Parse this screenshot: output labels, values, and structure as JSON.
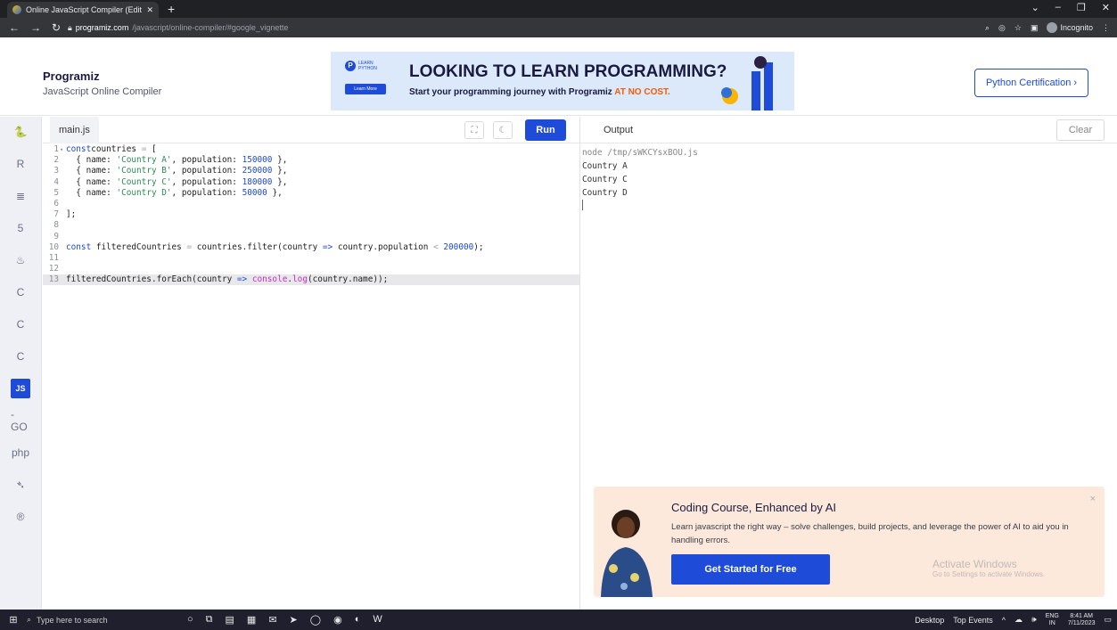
{
  "browser": {
    "tab_title": "Online JavaScript Compiler (Edit",
    "new_tab": "+",
    "url_host": "programiz.com",
    "url_path": "/javascript/online-compiler/#google_vignette",
    "incognito_label": "Incognito"
  },
  "header": {
    "logo": "Programiz",
    "subtitle": "JavaScript Online Compiler",
    "cert_button": "Python Certification ›"
  },
  "banner": {
    "badge_top": "LEARN",
    "badge_bottom": "PYTHON",
    "learn_more": "Learn More",
    "headline": "LOOKING TO LEARN PROGRAMMING?",
    "sub_prefix": "Start your programming journey with Programiz ",
    "sub_highlight": "AT NO COST."
  },
  "sidebar": {
    "items": [
      {
        "icon": "python-icon",
        "glyph": "🐍"
      },
      {
        "icon": "r-lang-icon",
        "glyph": "R"
      },
      {
        "icon": "sql-icon",
        "glyph": "≣"
      },
      {
        "icon": "html-icon",
        "glyph": "5"
      },
      {
        "icon": "java-icon",
        "glyph": "♨"
      },
      {
        "icon": "c-lang-icon",
        "glyph": "C"
      },
      {
        "icon": "cpp-icon",
        "glyph": "C"
      },
      {
        "icon": "csharp-icon",
        "glyph": "C"
      },
      {
        "icon": "javascript-icon",
        "glyph": "JS"
      },
      {
        "icon": "go-icon",
        "glyph": "-GO"
      },
      {
        "icon": "php-icon",
        "glyph": "php"
      },
      {
        "icon": "swift-icon",
        "glyph": "➴"
      },
      {
        "icon": "rust-icon",
        "glyph": "®"
      }
    ]
  },
  "editor": {
    "file_name": "main.js",
    "run_label": "Run",
    "lines": [
      {
        "n": "1",
        "fold": "▾",
        "tokens": [
          [
            "kw",
            "const"
          ],
          [
            "",
            "countries "
          ],
          [
            "op",
            "="
          ],
          [
            "",
            " ["
          ]
        ]
      },
      {
        "n": "2",
        "tokens": [
          [
            "",
            "  { name: "
          ],
          [
            "str",
            "'Country A'"
          ],
          [
            "",
            ", population: "
          ],
          [
            "num",
            "150000"
          ],
          [
            "",
            " },"
          ]
        ]
      },
      {
        "n": "3",
        "tokens": [
          [
            "",
            "  { name: "
          ],
          [
            "str",
            "'Country B'"
          ],
          [
            "",
            ", population: "
          ],
          [
            "num",
            "250000"
          ],
          [
            "",
            " },"
          ]
        ]
      },
      {
        "n": "4",
        "tokens": [
          [
            "",
            "  { name: "
          ],
          [
            "str",
            "'Country C'"
          ],
          [
            "",
            ", population: "
          ],
          [
            "num",
            "180000"
          ],
          [
            "",
            " },"
          ]
        ]
      },
      {
        "n": "5",
        "tokens": [
          [
            "",
            "  { name: "
          ],
          [
            "str",
            "'Country D'"
          ],
          [
            "",
            ", population: "
          ],
          [
            "num",
            "50000"
          ],
          [
            "",
            " },"
          ]
        ]
      },
      {
        "n": "6",
        "tokens": []
      },
      {
        "n": "7",
        "tokens": [
          [
            "",
            "];"
          ]
        ]
      },
      {
        "n": "8",
        "tokens": []
      },
      {
        "n": "9",
        "tokens": []
      },
      {
        "n": "10",
        "tokens": [
          [
            "kw",
            "const"
          ],
          [
            "",
            " filteredCountries "
          ],
          [
            "op",
            "="
          ],
          [
            "",
            " countries.filter(country "
          ],
          [
            "kw",
            "=>"
          ],
          [
            "",
            " country.population "
          ],
          [
            "op",
            "<"
          ],
          [
            "",
            " "
          ],
          [
            "num",
            "200000"
          ],
          [
            "",
            ");"
          ]
        ]
      },
      {
        "n": "11",
        "tokens": []
      },
      {
        "n": "12",
        "tokens": []
      },
      {
        "n": "13",
        "hl": true,
        "tokens": [
          [
            "",
            "filteredCountries.forEach(country "
          ],
          [
            "kw",
            "=>"
          ],
          [
            "",
            " "
          ],
          [
            "fn",
            "console"
          ],
          [
            "",
            "."
          ],
          [
            "fn",
            "log"
          ],
          [
            "",
            "(country.name));"
          ]
        ]
      }
    ]
  },
  "output": {
    "title": "Output",
    "clear_label": "Clear",
    "command": "node /tmp/sWKCYsxBOU.js",
    "lines": [
      "Country A",
      "Country C",
      "Country D"
    ]
  },
  "promo": {
    "title": "Coding Course, Enhanced by AI",
    "text": "Learn javascript the right way – solve challenges, build projects, and leverage the power of AI to aid you in handling errors.",
    "button": "Get Started for Free",
    "close": "×",
    "activate_title": "Activate Windows",
    "activate_sub": "Go to Settings to activate Windows."
  },
  "taskbar": {
    "search_placeholder": "Type here to search",
    "desktop_label": "Desktop",
    "top_events": "Top Events",
    "lang": "ENG",
    "region": "IN",
    "time": "8:41 AM",
    "date": "7/11/2023"
  }
}
